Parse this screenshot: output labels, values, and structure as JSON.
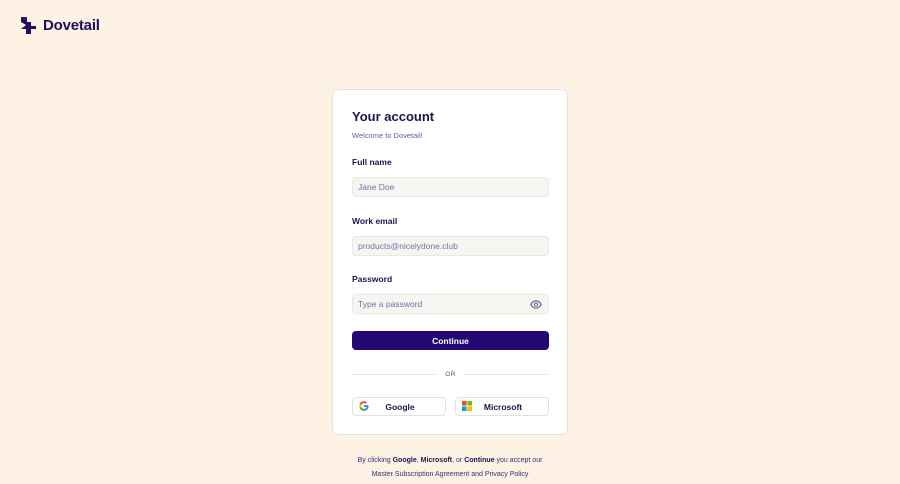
{
  "brand": {
    "name": "Dovetail",
    "color": "#1d0f5c"
  },
  "card": {
    "title": "Your account",
    "subtitle": "Welcome to Dovetail!"
  },
  "fields": {
    "full_name": {
      "label": "Full name",
      "placeholder": "Jane Doe",
      "value": ""
    },
    "work_email": {
      "label": "Work email",
      "placeholder": "products@nicelydone.club",
      "value": ""
    },
    "password": {
      "label": "Password",
      "placeholder": "Type a password",
      "value": "",
      "toggle_icon": "eye-icon"
    }
  },
  "actions": {
    "continue_label": "Continue",
    "continue_color": "#230873",
    "divider_text": "OR",
    "google_label": "Google",
    "microsoft_label": "Microsoft"
  },
  "legal": {
    "prefix": "By clicking",
    "google": "Google",
    "sep1": ",",
    "microsoft": "Microsoft",
    "sep2": ", or",
    "continue": "Continue",
    "suffix": "you accept our",
    "line2": "Master Subscription Agreement and Privacy Policy"
  },
  "colors": {
    "background": "#fdf2e4",
    "card": "#ffffff"
  }
}
